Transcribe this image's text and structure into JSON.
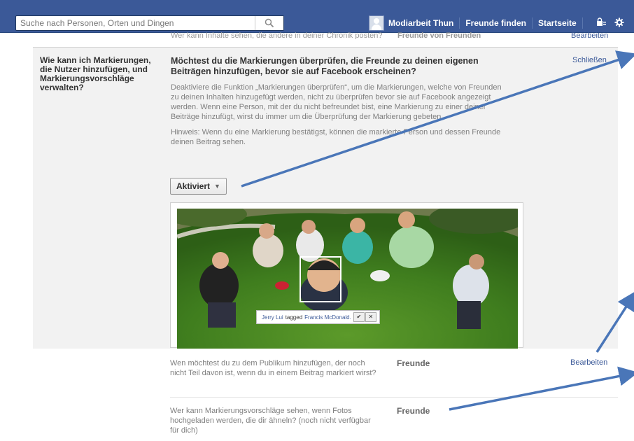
{
  "topbar": {
    "search_placeholder": "Suche nach Personen, Orten und Dingen",
    "profile_name": "Modiarbeit Thun",
    "nav": [
      "Freunde finden",
      "Startseite"
    ]
  },
  "partial_row": {
    "text": "Wer kann Inhalte sehen, die andere in deiner Chronik posten?",
    "value": "Freunde von Freunden",
    "action": "Bearbeiten"
  },
  "section": {
    "question": "Wie kann ich Markierungen, die Nutzer hinzufügen, und Markierungsvorschläge verwalten?",
    "heading": "Möchtest du die Markierungen überprüfen, die Freunde zu deinen eigenen Beiträgen hinzufügen, bevor sie auf Facebook erscheinen?",
    "close_label": "Schließen",
    "description": "Deaktiviere die Funktion „Markierungen überprüfen“, um die Markierungen, welche von Freunden zu deinen Inhalten hinzugefügt werden, nicht zu überprüfen bevor sie auf Facebook angezeigt werden. Wenn eine Person, mit der du nicht befreundet bist, eine Markierung zu einer deiner Beiträge hinzufügt, wirst du immer um die Überprüfung der Markierung gebeten.",
    "hint": "Hinweis: Wenn du eine Markierung bestätigst, können die markierte Person und dessen Freunde deinen Beitrag sehen.",
    "dropdown_value": "Aktiviert",
    "tag_bubble": {
      "name1": "Jerry Lui",
      "verb": "tagged",
      "name2": "Francis McDonald.",
      "confirm": "✔",
      "cancel": "✕"
    }
  },
  "rows": [
    {
      "question": "Wen möchtest du zu dem Publikum hinzufügen, der noch nicht Teil davon ist, wenn du in einem Beitrag markiert wirst?",
      "value": "Freunde",
      "action": "Bearbeiten"
    },
    {
      "question": "Wer kann Markierungsvorschläge sehen, wenn Fotos hochgeladen werden, die dir ähneln? (noch nicht verfügbar für dich)",
      "value": "Freunde",
      "action": ""
    }
  ],
  "colors": {
    "facebook_blue": "#3b5998",
    "annotation_arrow": "#4a76b8"
  }
}
